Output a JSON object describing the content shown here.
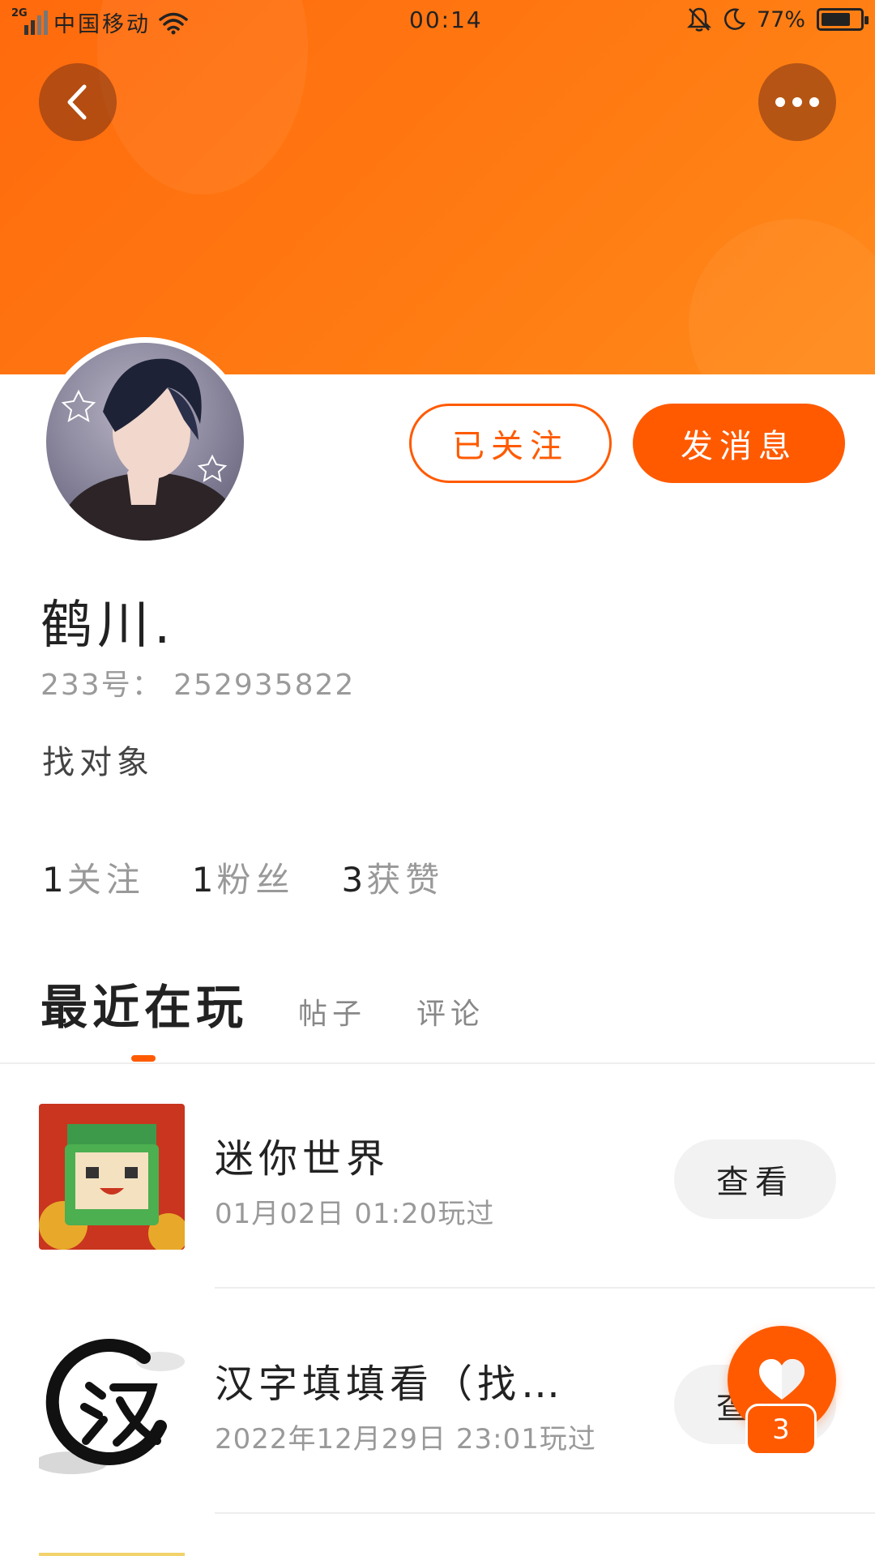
{
  "status_bar": {
    "network_tag": "2G",
    "carrier": "中国移动",
    "time": "00:14",
    "battery": "77%",
    "battery_level": 0.77
  },
  "profile": {
    "username": "鹤川.",
    "id_line": "233号： 252935822",
    "bio": "找对象",
    "follow_label": "已关注",
    "message_label": "发消息"
  },
  "stats": [
    {
      "num": "1",
      "label": "关注"
    },
    {
      "num": "1",
      "label": "粉丝"
    },
    {
      "num": "3",
      "label": "获赞"
    }
  ],
  "tabs": {
    "active": "最近在玩",
    "posts": "帖子",
    "comments": "评论"
  },
  "games": [
    {
      "title": "迷你世界",
      "played": "01月02日 01:20玩过",
      "button": "查看"
    },
    {
      "title": "汉字填填看（找…",
      "played": "2022年12月29日 23:01玩过",
      "button": "查看"
    }
  ],
  "like": {
    "count": "3"
  },
  "colors": {
    "accent": "#ff5a00",
    "banner": "#ff7a12"
  }
}
